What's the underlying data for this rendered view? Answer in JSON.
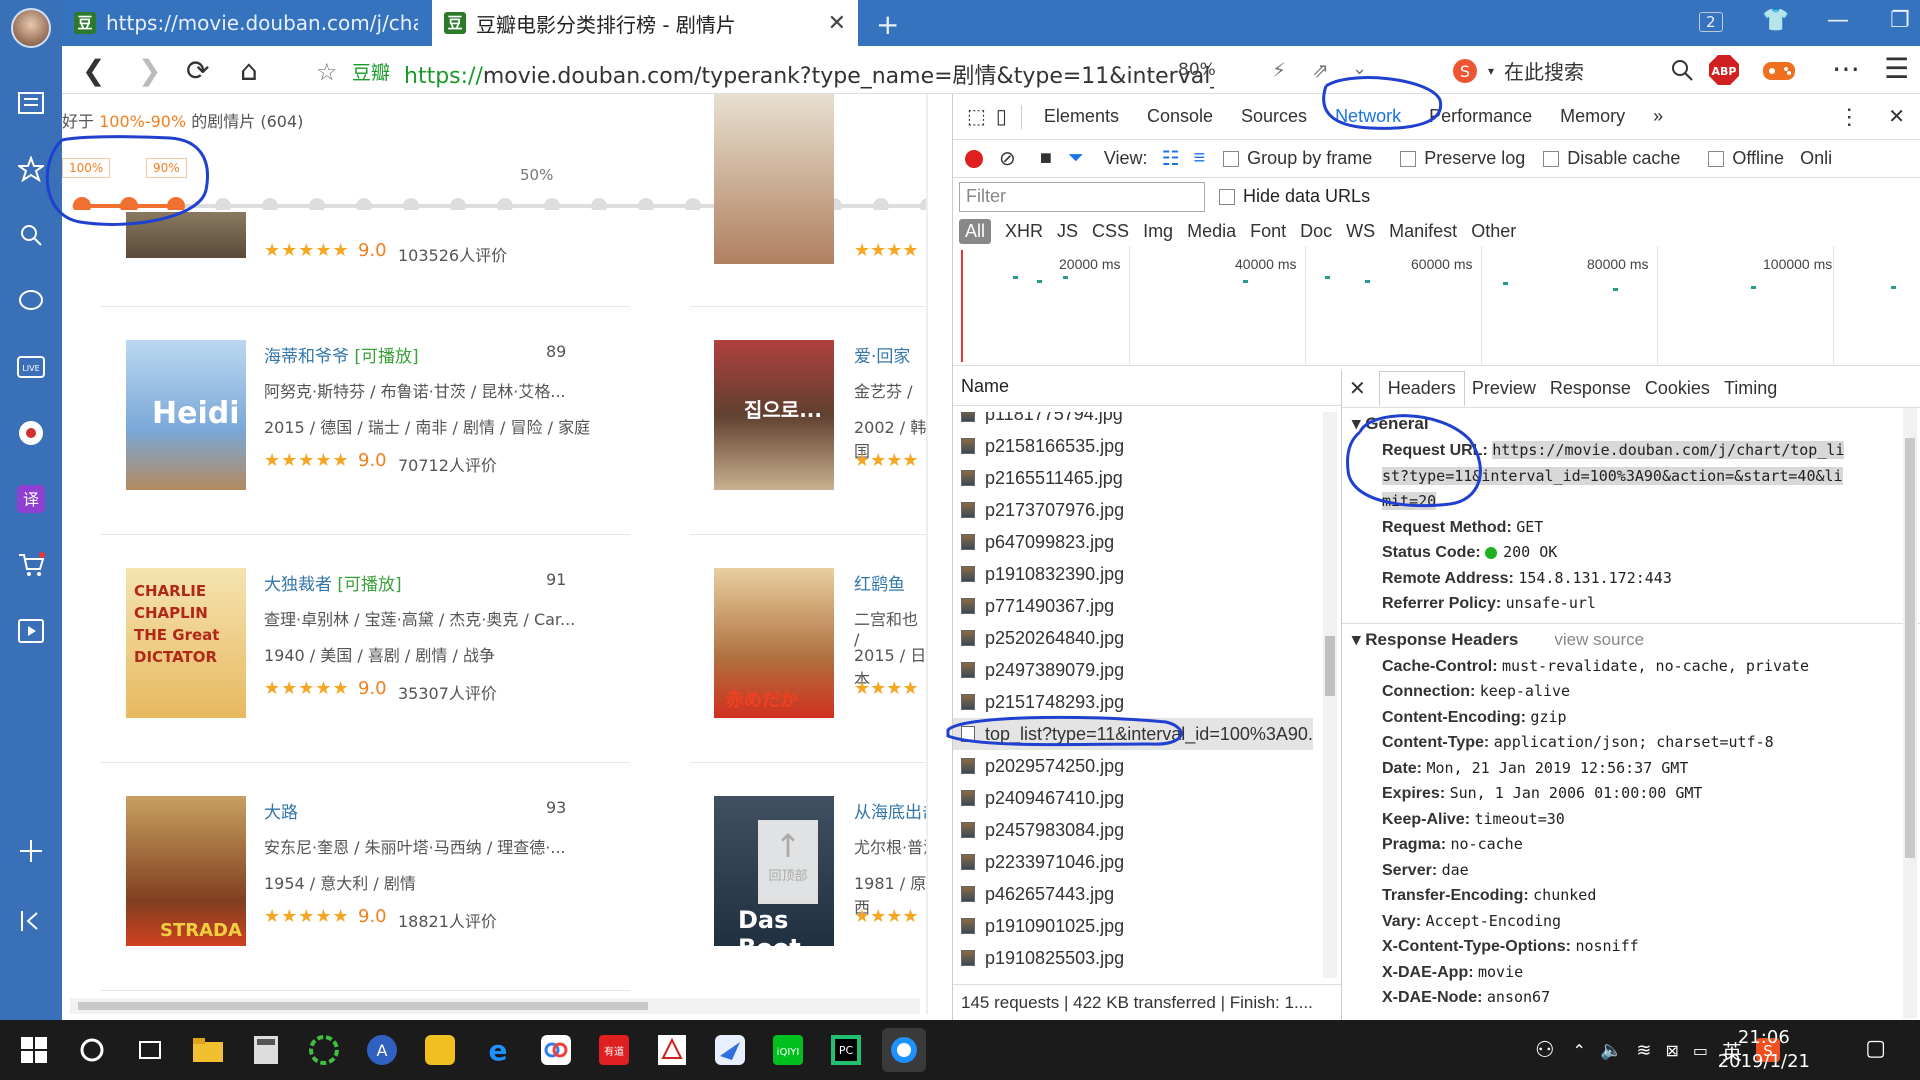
{
  "browser": {
    "tabs": [
      {
        "label": "https://movie.douban.com/j/chart/",
        "favicon": "豆"
      },
      {
        "label": "豆瓣电影分类排行榜 - 剧情片",
        "favicon": "豆"
      }
    ],
    "tab_count": "2",
    "address": {
      "site_label": "豆瓣",
      "scheme": "https://",
      "rest": "movie.douban.com/typerank?type_name=剧情&type=11&interval_i",
      "zoom": "80%",
      "search_placeholder": "在此搜索"
    }
  },
  "page": {
    "filter_title_prefix": "好于 ",
    "filter_title_range": "100%-90%",
    "filter_title_suffix": " 的剧情片 (604)",
    "slider": {
      "label_left": "100%",
      "label_right": "90%",
      "label_mid": "50%"
    },
    "back_to_top": "回顶部",
    "left_movies": [
      {
        "title": "",
        "rank": "",
        "line1": "",
        "line2": "",
        "stars": "★★★★★",
        "score": "9.0",
        "votes": "103526人评价"
      },
      {
        "title": "海蒂和爷爷",
        "play": "[可播放]",
        "rank": "89",
        "line1": "阿努克·斯特芬 / 布鲁诺·甘茨 / 昆林·艾格...",
        "line2": "2015 / 德国 / 瑞士 / 南非 / 剧情 / 冒险 / 家庭",
        "stars": "★★★★★",
        "score": "9.0",
        "votes": "70712人评价",
        "poster_text": "Heidi"
      },
      {
        "title": "大独裁者",
        "play": "[可播放]",
        "rank": "91",
        "line1": "查理·卓别林 / 宝莲·高黛 / 杰克·奥克 / Car...",
        "line2": "1940 / 美国 / 喜剧 / 剧情 / 战争",
        "stars": "★★★★★",
        "score": "9.0",
        "votes": "35307人评价",
        "poster_text": "CHARLIE CHAPLIN THE Great DICTATOR"
      },
      {
        "title": "大路",
        "play": "",
        "rank": "93",
        "line1": "安东尼·奎恩 / 朱丽叶塔·马西纳 / 理查德·...",
        "line2": "1954 / 意大利 / 剧情",
        "stars": "★★★★★",
        "score": "9.0",
        "votes": "18821人评价",
        "poster_text": "STRADA"
      }
    ],
    "right_movies": [
      {
        "title": "",
        "line1": "",
        "line2": "",
        "stars": "★★★★"
      },
      {
        "title": "爱·回家",
        "line1": "金艺芬 / ",
        "line2": "2002 / 韩国",
        "stars": "★★★★",
        "poster_text": "집으로..."
      },
      {
        "title": "红鹞鱼",
        "line1": "二宫和也 / ",
        "line2": "2015 / 日本",
        "stars": "★★★★",
        "poster_text": "赤めだか"
      },
      {
        "title": "从海底出击",
        "line1": "尤尔根·普洛",
        "line2": "1981 / 原西",
        "stars": "★★★★",
        "poster_text": "Das Boot"
      }
    ]
  },
  "devtools": {
    "tabs": [
      "Elements",
      "Console",
      "Sources",
      "Network",
      "Performance",
      "Memory",
      "»"
    ],
    "active_tab": "Network",
    "toolbar": {
      "view_label": "View:",
      "group_by_frame": "Group by frame",
      "preserve_log": "Preserve log",
      "disable_cache": "Disable cache",
      "offline": "Offline",
      "online": "Onli"
    },
    "filter_placeholder": "Filter",
    "hide_data_urls": "Hide data URLs",
    "types": [
      "All",
      "XHR",
      "JS",
      "CSS",
      "Img",
      "Media",
      "Font",
      "Doc",
      "WS",
      "Manifest",
      "Other"
    ],
    "timeline_marks": [
      "20000 ms",
      "40000 ms",
      "60000 ms",
      "80000 ms",
      "100000 ms"
    ],
    "name_header": "Name",
    "requests": [
      "p1181775794.jpg",
      "p2158166535.jpg",
      "p2165511465.jpg",
      "p2173707976.jpg",
      "p647099823.jpg",
      "p1910832390.jpg",
      "p771490367.jpg",
      "p2520264840.jpg",
      "p2497389079.jpg",
      "p2151748293.jpg",
      "top_list?type=11&interval_id=100%3A90...",
      "p2029574250.jpg",
      "p2409467410.jpg",
      "p2457983084.jpg",
      "p2233971046.jpg",
      "p462657443.jpg",
      "p1910901025.jpg",
      "p1910825503.jpg"
    ],
    "selected_index": 10,
    "status": "145 requests  |  422 KB transferred  |  Finish: 1....",
    "detail_tabs": [
      "Headers",
      "Preview",
      "Response",
      "Cookies",
      "Timing"
    ],
    "general_title": "General",
    "general": [
      {
        "k": "Request URL:",
        "v": "https://movie.douban.com/j/chart/top_li"
      },
      {
        "k": "",
        "v": "st?type=11&interval_id=100%3A90&action=&start=40&li"
      },
      {
        "k": "",
        "v": "mit=20"
      },
      {
        "k": "Request Method:",
        "v": "GET"
      },
      {
        "k": "Status Code:",
        "v": "200 OK"
      },
      {
        "k": "Remote Address:",
        "v": "154.8.131.172:443"
      },
      {
        "k": "Referrer Policy:",
        "v": "unsafe-url"
      }
    ],
    "response_title": "Response Headers",
    "view_source": "view source",
    "response_headers": [
      {
        "k": "Cache-Control:",
        "v": "must-revalidate, no-cache, private"
      },
      {
        "k": "Connection:",
        "v": "keep-alive"
      },
      {
        "k": "Content-Encoding:",
        "v": "gzip"
      },
      {
        "k": "Content-Type:",
        "v": "application/json; charset=utf-8"
      },
      {
        "k": "Date:",
        "v": "Mon, 21 Jan 2019 12:56:37 GMT"
      },
      {
        "k": "Expires:",
        "v": "Sun, 1 Jan 2006 01:00:00 GMT"
      },
      {
        "k": "Keep-Alive:",
        "v": "timeout=30"
      },
      {
        "k": "Pragma:",
        "v": "no-cache"
      },
      {
        "k": "Server:",
        "v": "dae"
      },
      {
        "k": "Transfer-Encoding:",
        "v": "chunked"
      },
      {
        "k": "Vary:",
        "v": "Accept-Encoding"
      },
      {
        "k": "X-Content-Type-Options:",
        "v": "nosniff"
      },
      {
        "k": "X-DAE-App:",
        "v": "movie"
      },
      {
        "k": "X-DAE-Node:",
        "v": "anson67"
      }
    ]
  },
  "taskbar": {
    "time": "21:06",
    "date": "2019/1/21",
    "ime": "英"
  },
  "colors": {
    "accent": "#1a73e8",
    "annotation": "#2040d0",
    "orange": "#f08020",
    "sidebar": "#3a70b8"
  }
}
